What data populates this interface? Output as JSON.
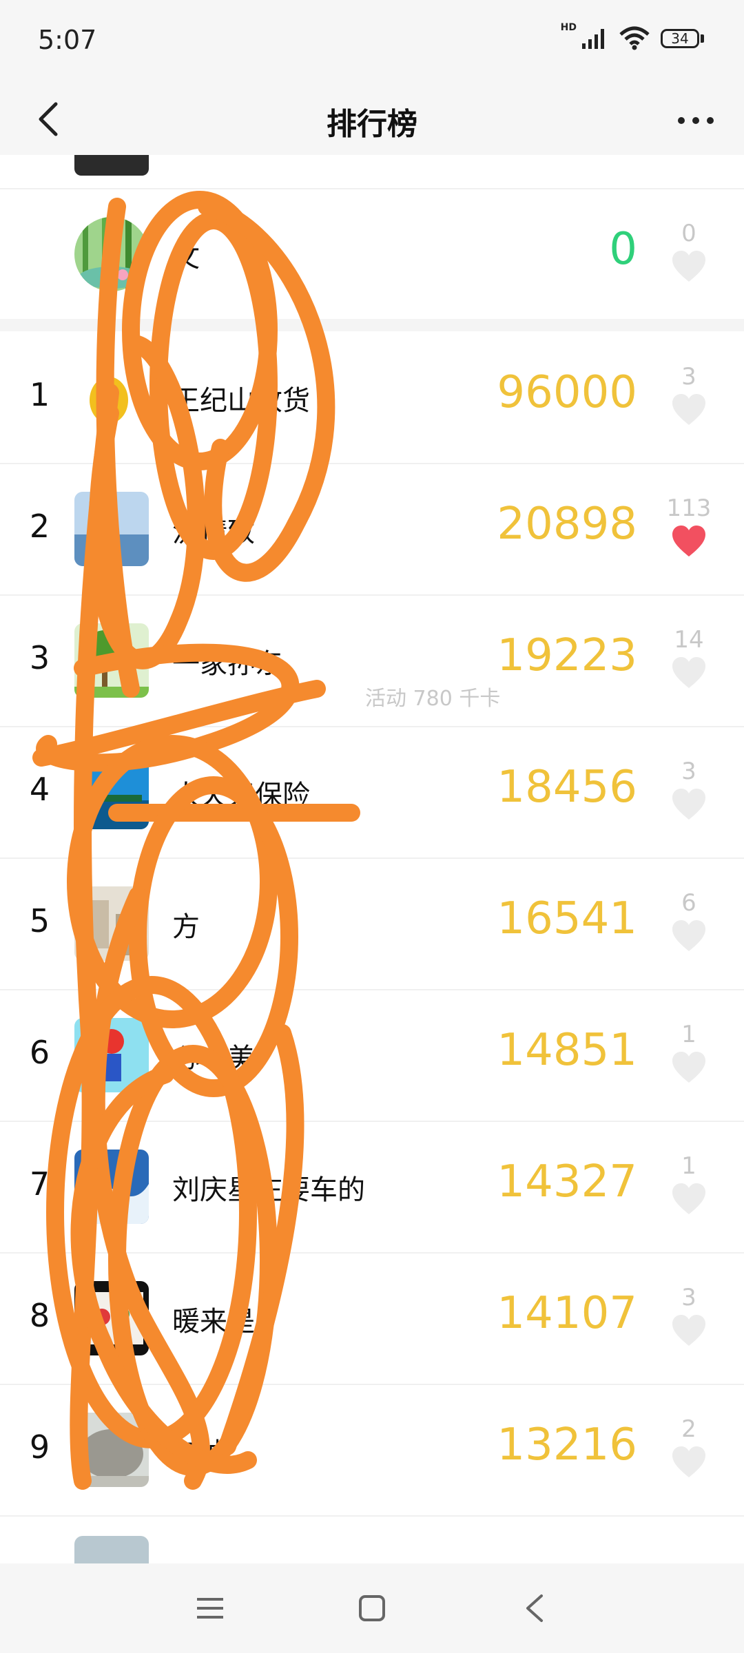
{
  "status": {
    "time": "5:07",
    "battery": "34",
    "hd": "HD"
  },
  "header": {
    "title": "排行榜"
  },
  "self": {
    "name": "文",
    "score": "0",
    "likes": "0"
  },
  "activity": "活动 780 千卡",
  "ranking": [
    {
      "rank": "1",
      "name": "王纪山收货",
      "score": "96000",
      "likes": "3",
      "liked": false
    },
    {
      "rank": "2",
      "name": "流精致",
      "score": "20898",
      "likes": "113",
      "liked": true
    },
    {
      "rank": "3",
      "name": "一家孙东",
      "score": "19223",
      "likes": "14",
      "liked": false
    },
    {
      "rank": "4",
      "name": "人天天保险",
      "score": "18456",
      "likes": "3",
      "liked": false
    },
    {
      "rank": "5",
      "name": "方",
      "score": "16541",
      "likes": "6",
      "liked": false
    },
    {
      "rank": "6",
      "name": "心中美",
      "score": "14851",
      "likes": "1",
      "liked": false
    },
    {
      "rank": "7",
      "name": "刘庆星庄要车的",
      "score": "14327",
      "likes": "1",
      "liked": false
    },
    {
      "rank": "8",
      "name": "暖来是",
      "score": "14107",
      "likes": "3",
      "liked": false
    },
    {
      "rank": "9",
      "name": "加油",
      "score": "13216",
      "likes": "2",
      "liked": false
    }
  ],
  "colors": {
    "score": "#f0c23a",
    "self_score": "#2fd07a",
    "heart_liked": "#f25060",
    "heart_default": "#e8e8e8",
    "scribble": "#f58a2e"
  }
}
